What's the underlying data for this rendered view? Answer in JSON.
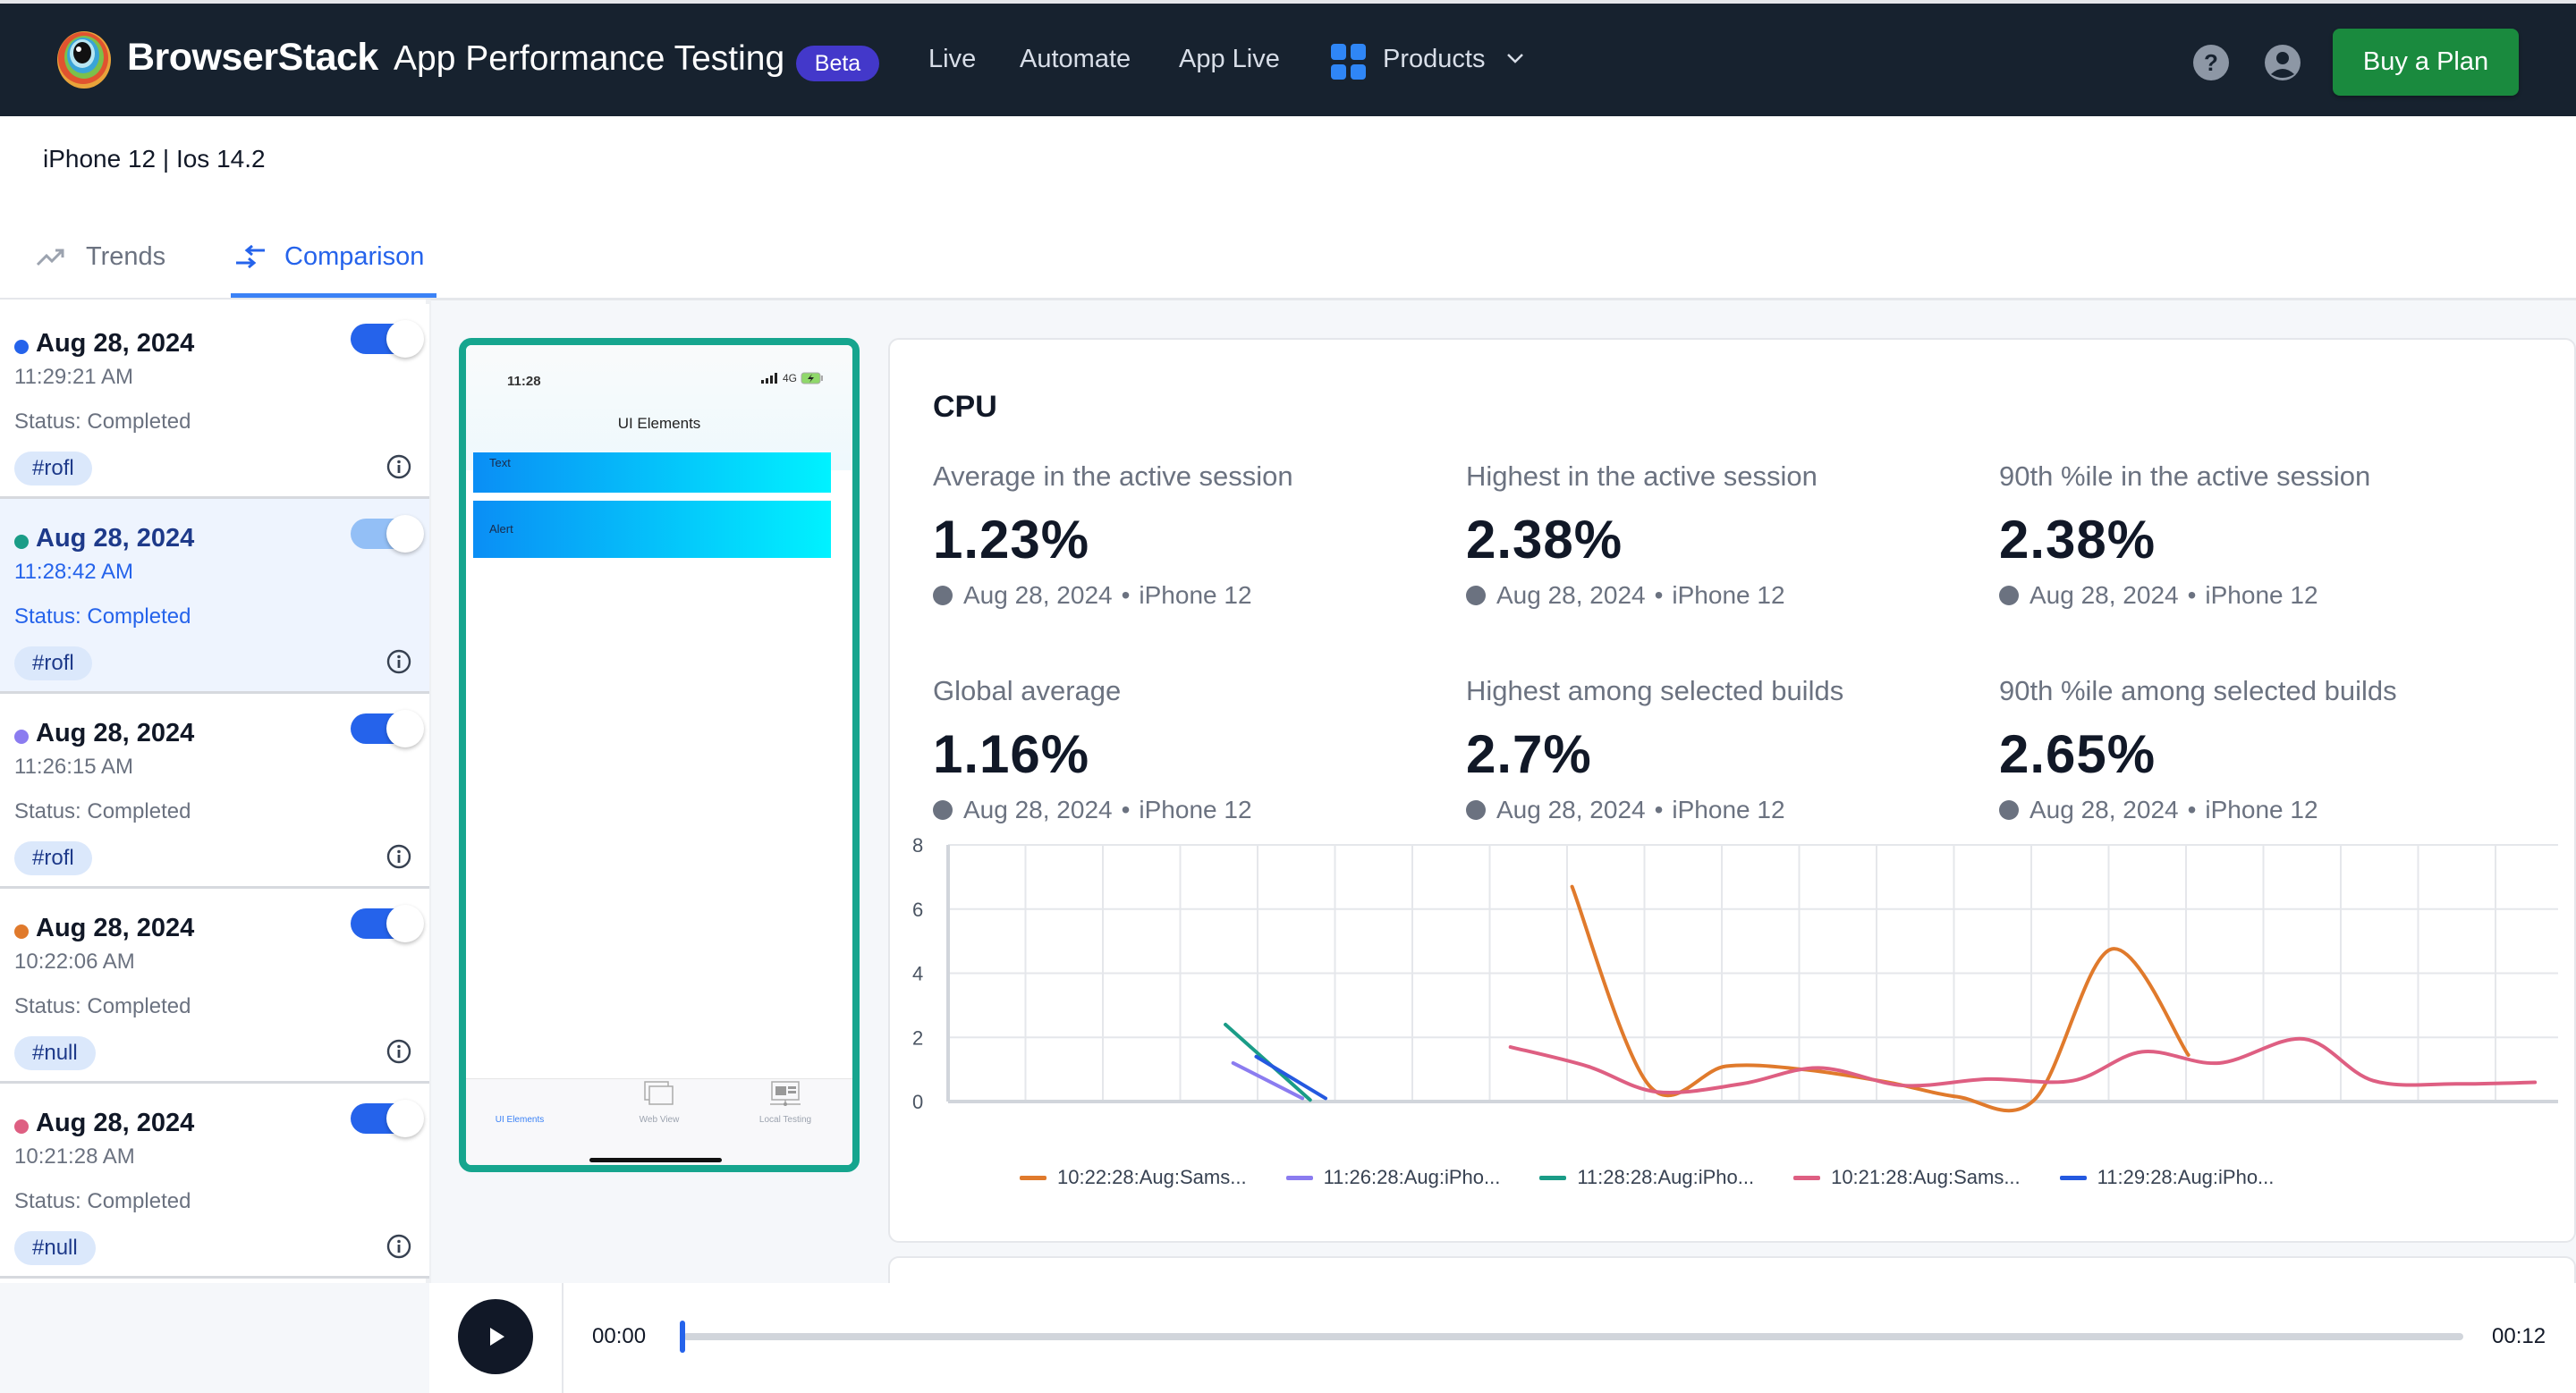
{
  "header": {
    "brand": "BrowserStack",
    "product": "App Performance Testing",
    "badge": "Beta",
    "nav": [
      "Live",
      "Automate",
      "App Live"
    ],
    "products_label": "Products",
    "buy_label": "Buy a Plan"
  },
  "subheader": {
    "device_title": "iPhone 12 | Ios 14.2",
    "tabs": [
      {
        "label": "Trends",
        "active": false
      },
      {
        "label": "Comparison",
        "active": true
      }
    ]
  },
  "builds": [
    {
      "date": "Aug 28, 2024",
      "time": "11:29:21 AM",
      "status": "Status: Completed",
      "tag": "#rofl",
      "color": "#2563eb",
      "enabled": true,
      "active": false
    },
    {
      "date": "Aug 28, 2024",
      "time": "11:28:42 AM",
      "status": "Status: Completed",
      "tag": "#rofl",
      "color": "#1a9c87",
      "enabled": true,
      "active": true
    },
    {
      "date": "Aug 28, 2024",
      "time": "11:26:15 AM",
      "status": "Status: Completed",
      "tag": "#rofl",
      "color": "#8b7cf0",
      "enabled": true,
      "active": false
    },
    {
      "date": "Aug 28, 2024",
      "time": "10:22:06 AM",
      "status": "Status: Completed",
      "tag": "#null",
      "color": "#e07a2c",
      "enabled": true,
      "active": false
    },
    {
      "date": "Aug 28, 2024",
      "time": "10:21:28 AM",
      "status": "Status: Completed",
      "tag": "#null",
      "color": "#de5f82",
      "enabled": true,
      "active": false
    }
  ],
  "phone": {
    "time": "11:28",
    "network": "4G",
    "title": "UI Elements",
    "rows": [
      "Text",
      "Alert"
    ],
    "tabs": [
      "UI Elements",
      "Web View",
      "Local Testing"
    ]
  },
  "cpu": {
    "title": "CPU",
    "stats": [
      {
        "label": "Average in the active session",
        "value": "1.23%",
        "date": "Aug 28, 2024",
        "device": "iPhone 12"
      },
      {
        "label": "Highest in the active session",
        "value": "2.38%",
        "date": "Aug 28, 2024",
        "device": "iPhone 12"
      },
      {
        "label": "90th %ile in the active session",
        "value": "2.38%",
        "date": "Aug 28, 2024",
        "device": "iPhone 12"
      },
      {
        "label": "Global average",
        "value": "1.16%",
        "date": "Aug 28, 2024",
        "device": "iPhone 12"
      },
      {
        "label": "Highest among selected builds",
        "value": "2.7%",
        "date": "Aug 28, 2024",
        "device": "iPhone 12"
      },
      {
        "label": "90th %ile among selected builds",
        "value": "2.65%",
        "date": "Aug 28, 2024",
        "device": "iPhone 12"
      }
    ]
  },
  "chart_data": {
    "type": "line",
    "title": "CPU",
    "xlabel": "",
    "ylabel": "",
    "xlim": [
      0,
      20.9
    ],
    "ylim": [
      0,
      8
    ],
    "yticks": [
      0,
      2,
      4,
      6,
      8
    ],
    "grid": true,
    "legend": "bottom",
    "series": [
      {
        "name": "10:22:28:Aug:Sams...",
        "color": "#e07a2c",
        "points": [
          [
            8.1,
            6.7
          ],
          [
            9.1,
            0.5
          ],
          [
            10.1,
            1.1
          ],
          [
            11.1,
            1.0
          ],
          [
            12.2,
            0.6
          ],
          [
            13.1,
            0.15
          ],
          [
            14.1,
            0.05
          ],
          [
            15.1,
            4.75
          ],
          [
            16.1,
            1.45
          ]
        ]
      },
      {
        "name": "11:26:28:Aug:iPho...",
        "color": "#8b7cf0",
        "points": [
          [
            3.7,
            1.2
          ],
          [
            4.6,
            0.1
          ]
        ]
      },
      {
        "name": "11:28:28:Aug:iPho...",
        "color": "#1a9c87",
        "points": [
          [
            3.6,
            2.4
          ],
          [
            4.7,
            0.05
          ]
        ]
      },
      {
        "name": "10:21:28:Aug:Sams...",
        "color": "#de5f82",
        "points": [
          [
            7.3,
            1.7
          ],
          [
            8.3,
            1.1
          ],
          [
            9.2,
            0.3
          ],
          [
            10.3,
            0.55
          ],
          [
            11.3,
            1.05
          ],
          [
            12.4,
            0.5
          ],
          [
            13.5,
            0.7
          ],
          [
            14.6,
            0.65
          ],
          [
            15.5,
            1.55
          ],
          [
            16.5,
            1.2
          ],
          [
            17.6,
            1.95
          ],
          [
            18.5,
            0.65
          ],
          [
            19.6,
            0.55
          ],
          [
            20.6,
            0.6
          ]
        ]
      },
      {
        "name": "11:29:28:Aug:iPho...",
        "color": "#2459e0",
        "points": [
          [
            4.0,
            1.4
          ],
          [
            4.9,
            0.1
          ]
        ]
      }
    ]
  },
  "player": {
    "current": "00:00",
    "duration": "00:12",
    "progress": 0
  }
}
